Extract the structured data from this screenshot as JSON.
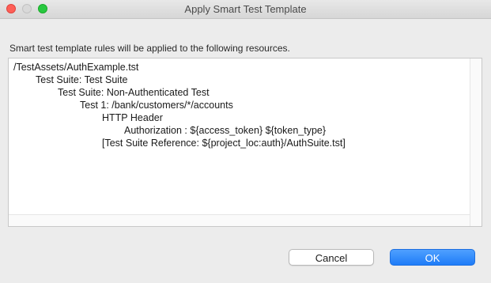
{
  "window": {
    "title": "Apply Smart Test Template"
  },
  "dialog": {
    "description": "Smart test template rules will be applied to the following resources.",
    "tree": [
      {
        "level": 0,
        "text": "/TestAssets/AuthExample.tst"
      },
      {
        "level": 1,
        "text": "Test Suite: Test Suite"
      },
      {
        "level": 2,
        "text": "Test Suite: Non-Authenticated Test"
      },
      {
        "level": 3,
        "text": "Test 1: /bank/customers/*/accounts"
      },
      {
        "level": 4,
        "text": "HTTP Header"
      },
      {
        "level": 5,
        "text": "Authorization : ${access_token} ${token_type}"
      },
      {
        "level": 4,
        "text": "[Test Suite Reference: ${project_loc:auth}/AuthSuite.tst]"
      }
    ]
  },
  "buttons": {
    "cancel_label": "Cancel",
    "ok_label": "OK"
  },
  "colors": {
    "accent": "#1e7cf7",
    "close": "#fe5f57",
    "maximize": "#28c840"
  }
}
